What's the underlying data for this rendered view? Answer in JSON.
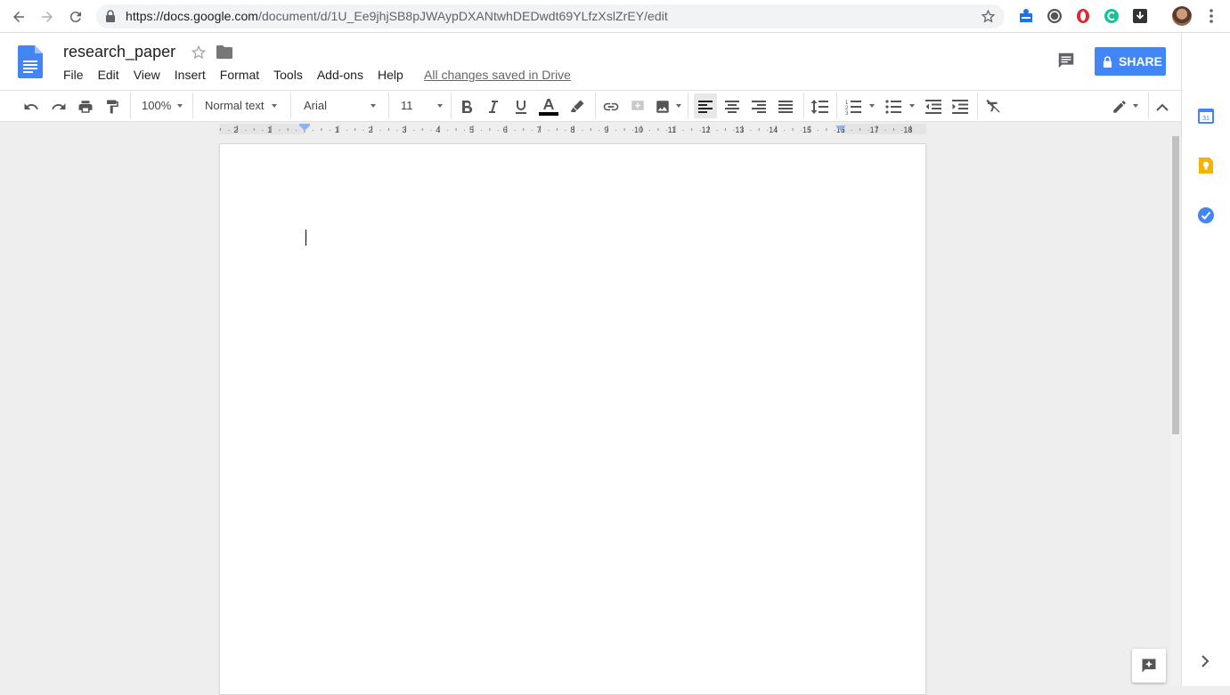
{
  "browser": {
    "url_host": "https://docs.google.com",
    "url_path": "/document/d/1U_Ee9jhjSB8pJWAypDXANtwhDEDwdt69YLfzXslZrEY/edit",
    "icons": [
      "back-icon",
      "forward-icon",
      "reload-icon",
      "lock-icon",
      "bookmark-star-icon",
      "extension-icon",
      "menu-dots-icon"
    ]
  },
  "document": {
    "title": "research_paper",
    "save_status": "All changes saved in Drive"
  },
  "menu": {
    "items": [
      "File",
      "Edit",
      "View",
      "Insert",
      "Format",
      "Tools",
      "Add-ons",
      "Help"
    ]
  },
  "header": {
    "share_label": "SHARE"
  },
  "toolbar": {
    "zoom": "100%",
    "style": "Normal text",
    "font": "Arial",
    "font_size": "11"
  },
  "ruler": {
    "labels": [
      "2",
      "1",
      "1",
      "2",
      "3",
      "4",
      "5",
      "6",
      "7",
      "8",
      "9",
      "10",
      "11",
      "12",
      "13",
      "14",
      "15",
      "16",
      "17",
      "18"
    ]
  },
  "colors": {
    "accent": "#4285f4",
    "text_color_bar": "#000000"
  }
}
